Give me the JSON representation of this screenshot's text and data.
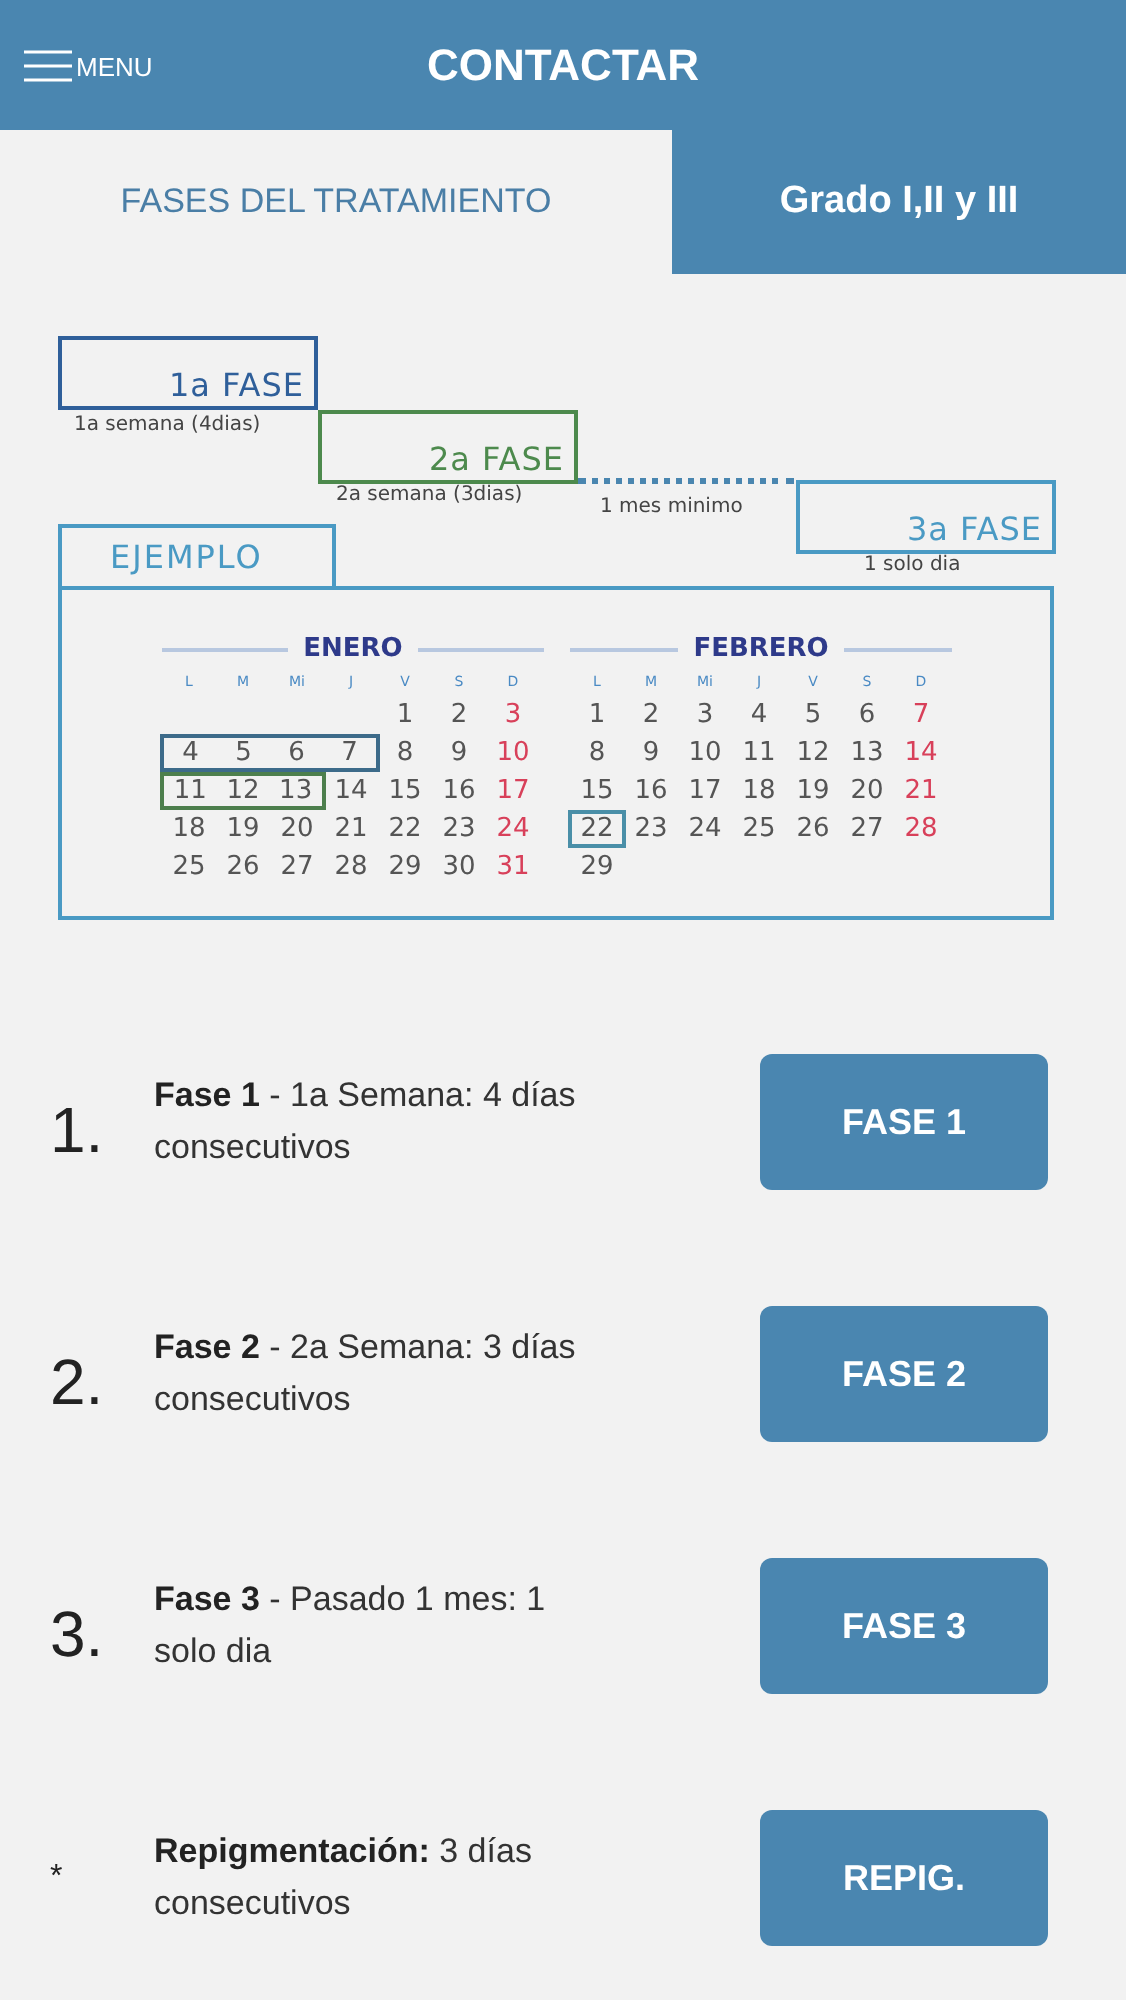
{
  "header": {
    "menu_label": "MENU",
    "title": "CONTACTAR"
  },
  "tabs": [
    {
      "label": "FASES DEL TRATAMIENTO",
      "selected": true
    },
    {
      "label": "Grado I,II y III",
      "selected": false
    }
  ],
  "diagram": {
    "phases": [
      {
        "label": "1a FASE",
        "caption": "1a semana (4dias)",
        "color": "#2f5f9a"
      },
      {
        "label": "2a FASE",
        "caption": "2a semana (3dias)",
        "color": "#4d8a4d"
      },
      {
        "label": "3a FASE",
        "caption": "1 solo dia",
        "color": "#4a9ac4"
      }
    ],
    "gap_caption": "1 mes minimo",
    "example_label": "EJEMPLO"
  },
  "calendar": {
    "months": [
      {
        "name": "ENERO",
        "weekdays": [
          "L",
          "M",
          "Mi",
          "J",
          "V",
          "S",
          "D"
        ],
        "weeks": [
          [
            {
              "kind": "blank"
            },
            {
              "kind": "blank"
            },
            {
              "kind": "blank"
            },
            {
              "kind": "blank"
            },
            {
              "kind": "day",
              "d": "1"
            },
            {
              "kind": "day",
              "d": "2"
            },
            {
              "kind": "day",
              "d": "3"
            }
          ],
          [
            {
              "kind": "day",
              "d": "4",
              "color": "#3d6b8a"
            },
            {
              "kind": "day",
              "d": "5",
              "color": "#3d6b8a"
            },
            {
              "kind": "day",
              "d": "6",
              "color": "#3d6b8a"
            },
            {
              "kind": "day",
              "d": "7",
              "color": "#3d6b8a"
            },
            {
              "kind": "day",
              "d": "8"
            },
            {
              "kind": "day",
              "d": "9"
            },
            {
              "kind": "day",
              "d": "10"
            }
          ],
          [
            {
              "kind": "day",
              "d": "11",
              "color": "#4d7f4d"
            },
            {
              "kind": "day",
              "d": "12",
              "color": "#4d7f4d"
            },
            {
              "kind": "day",
              "d": "13",
              "color": "#4d7f4d"
            },
            {
              "kind": "day",
              "d": "14"
            },
            {
              "kind": "day",
              "d": "15"
            },
            {
              "kind": "day",
              "d": "16"
            },
            {
              "kind": "day",
              "d": "17"
            }
          ],
          [
            {
              "kind": "day",
              "d": "18"
            },
            {
              "kind": "day",
              "d": "19"
            },
            {
              "kind": "day",
              "d": "20"
            },
            {
              "kind": "day",
              "d": "21"
            },
            {
              "kind": "day",
              "d": "22"
            },
            {
              "kind": "day",
              "d": "23"
            },
            {
              "kind": "day",
              "d": "24"
            }
          ],
          [
            {
              "kind": "day",
              "d": "25"
            },
            {
              "kind": "day",
              "d": "26"
            },
            {
              "kind": "day",
              "d": "27"
            },
            {
              "kind": "day",
              "d": "28"
            },
            {
              "kind": "day",
              "d": "29"
            },
            {
              "kind": "day",
              "d": "30"
            },
            {
              "kind": "day",
              "d": "31"
            }
          ]
        ]
      },
      {
        "name": "FEBRERO",
        "weekdays": [
          "L",
          "M",
          "Mi",
          "J",
          "V",
          "S",
          "D"
        ],
        "weeks": [
          [
            {
              "kind": "day",
              "d": "1"
            },
            {
              "kind": "day",
              "d": "2"
            },
            {
              "kind": "day",
              "d": "3"
            },
            {
              "kind": "day",
              "d": "4"
            },
            {
              "kind": "day",
              "d": "5"
            },
            {
              "kind": "day",
              "d": "6"
            },
            {
              "kind": "day",
              "d": "7"
            }
          ],
          [
            {
              "kind": "day",
              "d": "8"
            },
            {
              "kind": "day",
              "d": "9"
            },
            {
              "kind": "day",
              "d": "10"
            },
            {
              "kind": "day",
              "d": "11"
            },
            {
              "kind": "day",
              "d": "12"
            },
            {
              "kind": "day",
              "d": "13"
            },
            {
              "kind": "day",
              "d": "14"
            }
          ],
          [
            {
              "kind": "day",
              "d": "15"
            },
            {
              "kind": "day",
              "d": "16"
            },
            {
              "kind": "day",
              "d": "17"
            },
            {
              "kind": "day",
              "d": "18"
            },
            {
              "kind": "day",
              "d": "19"
            },
            {
              "kind": "day",
              "d": "20"
            },
            {
              "kind": "day",
              "d": "21"
            }
          ],
          [
            {
              "kind": "day",
              "d": "22",
              "color": "#4a8fa8"
            },
            {
              "kind": "day",
              "d": "23"
            },
            {
              "kind": "day",
              "d": "24"
            },
            {
              "kind": "day",
              "d": "25"
            },
            {
              "kind": "day",
              "d": "26"
            },
            {
              "kind": "day",
              "d": "27"
            },
            {
              "kind": "day",
              "d": "28"
            }
          ],
          [
            {
              "kind": "day",
              "d": "29"
            }
          ]
        ]
      }
    ]
  },
  "steps": [
    {
      "kind": "step",
      "number": "1.",
      "text": "**Fase 1** - 1a Semana: 4 días consecutivos",
      "button": "FASE 1"
    },
    {
      "kind": "step",
      "number": "2.",
      "text": "**Fase 2** - 2a Semana: 3 días consecutivos",
      "button": "FASE 2"
    },
    {
      "kind": "step",
      "number": "3.",
      "text": "**Fase 3** - Pasado 1 mes: 1 solo dia",
      "button": "FASE 3"
    },
    {
      "kind": "note",
      "number": "*",
      "text": "**Repigmentación:** 3 días consecutivos",
      "button": "REPIG."
    }
  ]
}
